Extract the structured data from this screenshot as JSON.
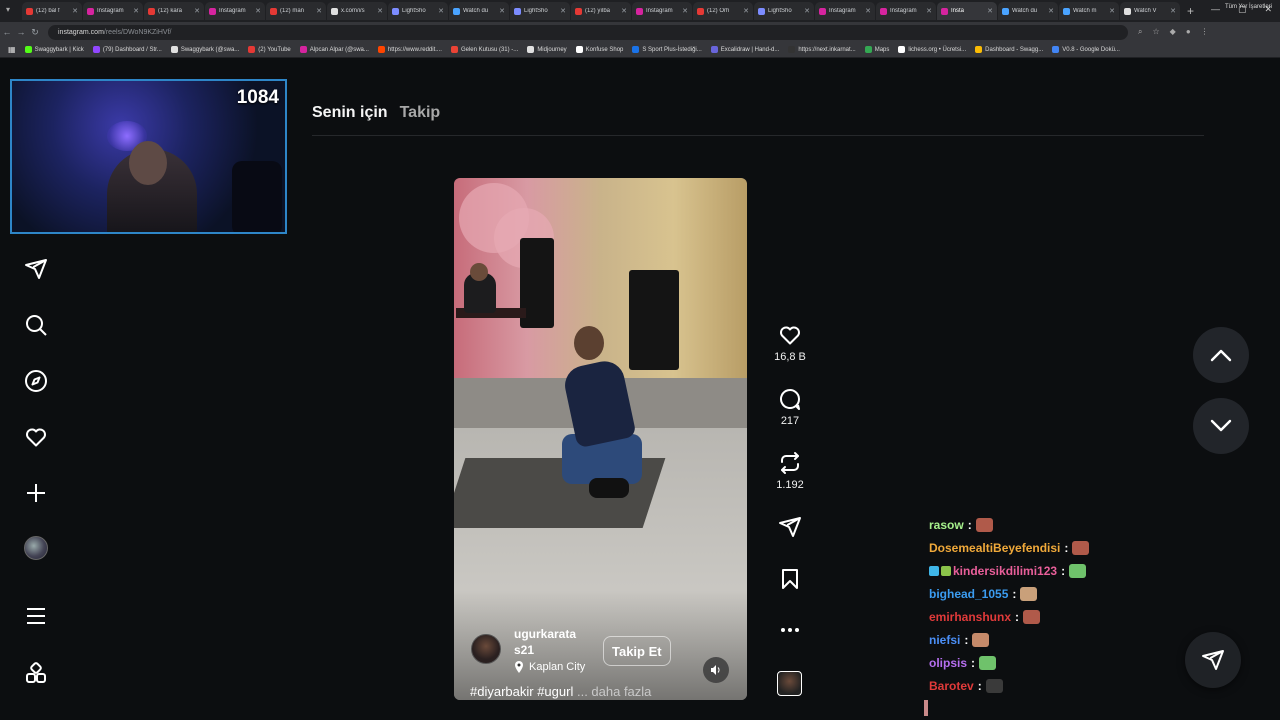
{
  "browser": {
    "tabs": [
      {
        "title": "(12) bal f",
        "color": "#e53935"
      },
      {
        "title": "Instagram",
        "color": "#d6249f"
      },
      {
        "title": "(12) kara",
        "color": "#e53935"
      },
      {
        "title": "Instagram",
        "color": "#d6249f"
      },
      {
        "title": "(12) man",
        "color": "#e53935"
      },
      {
        "title": "x.com/i/s",
        "color": "#e0e0e0"
      },
      {
        "title": "LightSho",
        "color": "#7c8cff"
      },
      {
        "title": "Watch du",
        "color": "#4aa3ff"
      },
      {
        "title": "LightSho",
        "color": "#7c8cff"
      },
      {
        "title": "(12) yılba",
        "color": "#e53935"
      },
      {
        "title": "Instagram",
        "color": "#d6249f"
      },
      {
        "title": "(12) Orh",
        "color": "#e53935"
      },
      {
        "title": "LightSho",
        "color": "#7c8cff"
      },
      {
        "title": "Instagram",
        "color": "#d6249f"
      },
      {
        "title": "Instagram",
        "color": "#d6249f"
      },
      {
        "title": "Insta",
        "color": "#d6249f"
      },
      {
        "title": "Watch du",
        "color": "#4aa3ff"
      },
      {
        "title": "Watch m",
        "color": "#4aa3ff"
      },
      {
        "title": "Watch V",
        "color": "#e0e0e0"
      }
    ],
    "active_tab": 15,
    "url_host": "instagram.com",
    "url_path": "/reels/DWoN9KZiHVf/",
    "bookmarks": [
      {
        "label": "Swaggybark | Kick",
        "color": "#53fc18"
      },
      {
        "label": "(79) Dashboard / Str...",
        "color": "#9147ff"
      },
      {
        "label": "Swaggybark (@swa...",
        "color": "#e0e0e0"
      },
      {
        "label": "(2) YouTube",
        "color": "#e53935"
      },
      {
        "label": "Alpcan Alpar (@swa...",
        "color": "#d6249f"
      },
      {
        "label": "https://www.reddit....",
        "color": "#ff4500"
      },
      {
        "label": "Gelen Kutusu (31) -...",
        "color": "#ea4335"
      },
      {
        "label": "Midjourney",
        "color": "#e0e0e0"
      },
      {
        "label": "Konfuse Shop",
        "color": "#ffffff"
      },
      {
        "label": "S Sport Plus-İstediği...",
        "color": "#1a73e8"
      },
      {
        "label": "Excalidraw | Hand-d...",
        "color": "#6965db"
      },
      {
        "label": "https://next.inkarnat...",
        "color": "#333333"
      },
      {
        "label": "Maps",
        "color": "#34a853"
      },
      {
        "label": "lichess.org • Ücretsi...",
        "color": "#ffffff"
      },
      {
        "label": "Dashboard - Swagg...",
        "color": "#fbbc05"
      },
      {
        "label": "V0.8 - Google Dokü...",
        "color": "#4285f4"
      }
    ],
    "bookmarks_right": "Tüm Yer İşaretleri"
  },
  "stream": {
    "viewer_count": "1084"
  },
  "feed": {
    "tab_for_you": "Senin için",
    "tab_following": "Takip"
  },
  "reel": {
    "username_line1": "ugurkarata",
    "username_line2": "s21",
    "location": "Kaplan City",
    "follow_label": "Takip Et",
    "caption": "#diyarbakir #ugurl",
    "caption_more": "... daha fazla",
    "likes": "16,8 B",
    "comments": "217",
    "reposts": "1.192"
  },
  "chat": [
    {
      "user": "rasow",
      "color": "#a6f08c",
      "emote": "#b05a4a",
      "badges": []
    },
    {
      "user": "DosemealtiBeyefendisi",
      "color": "#f0a93a",
      "emote": "#b05a4a",
      "badges": []
    },
    {
      "user": "kindersikdilimi123",
      "color": "#e95f9a",
      "emote": "#6fc26b",
      "badges": [
        "#3fb6e8",
        "#8bc34a"
      ]
    },
    {
      "user": "bighead_1055",
      "color": "#3b9cf0",
      "emote": "#c9a07a",
      "badges": []
    },
    {
      "user": "emirhanshunx",
      "color": "#e03a3a",
      "emote": "#b05a4a",
      "badges": []
    },
    {
      "user": "niefsi",
      "color": "#4b8ff7",
      "emote": "#c58a6a",
      "badges": []
    },
    {
      "user": "olipsis",
      "color": "#b66ff0",
      "emote": "#6fc26b",
      "badges": []
    },
    {
      "user": "Barotev",
      "color": "#e03a3a",
      "emote": "#3a3a3a",
      "badges": []
    }
  ]
}
